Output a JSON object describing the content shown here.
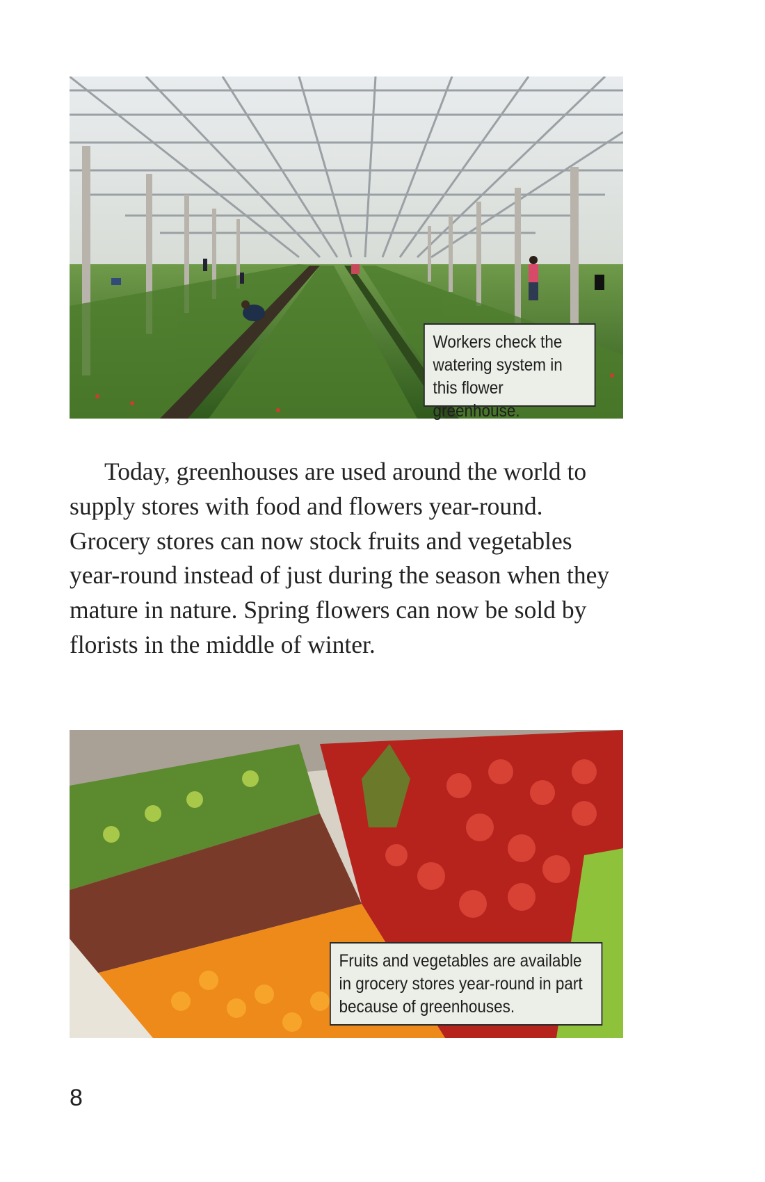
{
  "page": {
    "number": "8",
    "figures": [
      {
        "image": "greenhouse-photo",
        "caption": "Workers check the watering system in this flower greenhouse."
      },
      {
        "image": "grocery-produce-photo",
        "caption": "Fruits and vegetables are available in grocery stores year-round in part because of greenhouses."
      }
    ],
    "paragraph": "Today, greenhouses are used around the world to supply stores with food and flowers year-round. Grocery stores can now stock fruits and vegetables year-round instead of just during the season when they mature in nature. Spring flowers can now be sold by florists in the middle of winter."
  }
}
